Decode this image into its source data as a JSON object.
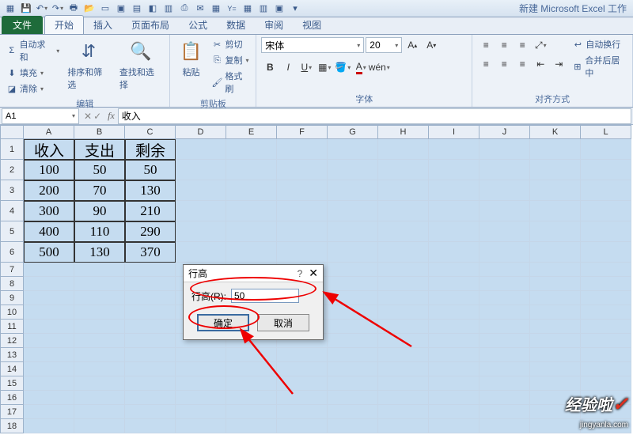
{
  "app_title": "新建 Microsoft Excel 工作",
  "tabs": {
    "file": "文件",
    "items": [
      "开始",
      "插入",
      "页面布局",
      "公式",
      "数据",
      "审阅",
      "视图"
    ],
    "active": 0
  },
  "ribbon": {
    "clipboard": {
      "label": "剪贴板",
      "paste": "粘贴",
      "cut": "剪切",
      "copy": "复制",
      "format": "格式刷"
    },
    "edit": {
      "label": "编辑",
      "autosum": "自动求和",
      "fill": "填充",
      "clear": "清除",
      "sort": "排序和筛选",
      "find": "查找和选择"
    },
    "font": {
      "label": "字体",
      "name": "宋体",
      "size": "20"
    },
    "align": {
      "label": "对齐方式",
      "wrap": "自动换行",
      "merge": "合并后居中"
    }
  },
  "namebox": "A1",
  "formula": "收入",
  "columns": [
    "A",
    "B",
    "C",
    "D",
    "E",
    "F",
    "G",
    "H",
    "I",
    "J",
    "K",
    "L"
  ],
  "rows_header": [
    "收入",
    "支出",
    "剩余"
  ],
  "rows_data": [
    [
      "100",
      "50",
      "50"
    ],
    [
      "200",
      "70",
      "130"
    ],
    [
      "300",
      "90",
      "210"
    ],
    [
      "400",
      "110",
      "290"
    ],
    [
      "500",
      "130",
      "370"
    ]
  ],
  "dialog": {
    "title": "行高",
    "label": "行高(R):",
    "value": "50",
    "ok": "确定",
    "cancel": "取消"
  },
  "watermark": {
    "main": "经验啦",
    "sub": "jingyanla.com"
  }
}
